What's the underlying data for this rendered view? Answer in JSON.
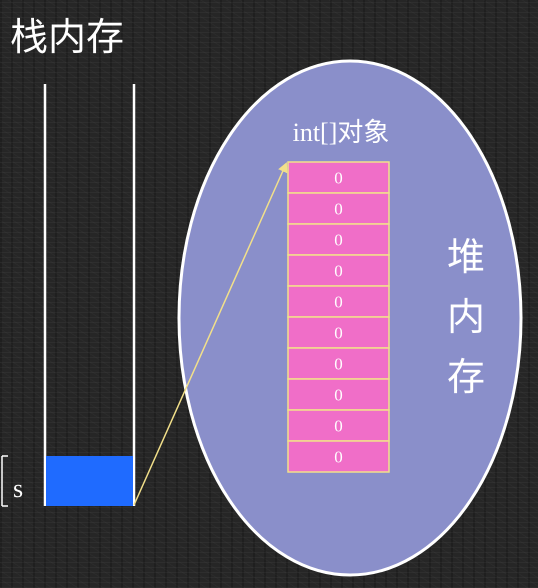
{
  "stack": {
    "title": "栈内存",
    "variable": {
      "name": "s",
      "color": "#1f6bff"
    }
  },
  "heap": {
    "label_chars": [
      "堆",
      "内",
      "存"
    ],
    "fill_color": "#8a8fca",
    "object": {
      "label": "int[]对象",
      "cell_color": "#f06ec8",
      "cell_border_color": "#f2e08a",
      "cells": [
        "0",
        "0",
        "0",
        "0",
        "0",
        "0",
        "0",
        "0",
        "0",
        "0"
      ]
    }
  },
  "reference_arrow_color": "#f2e08a"
}
